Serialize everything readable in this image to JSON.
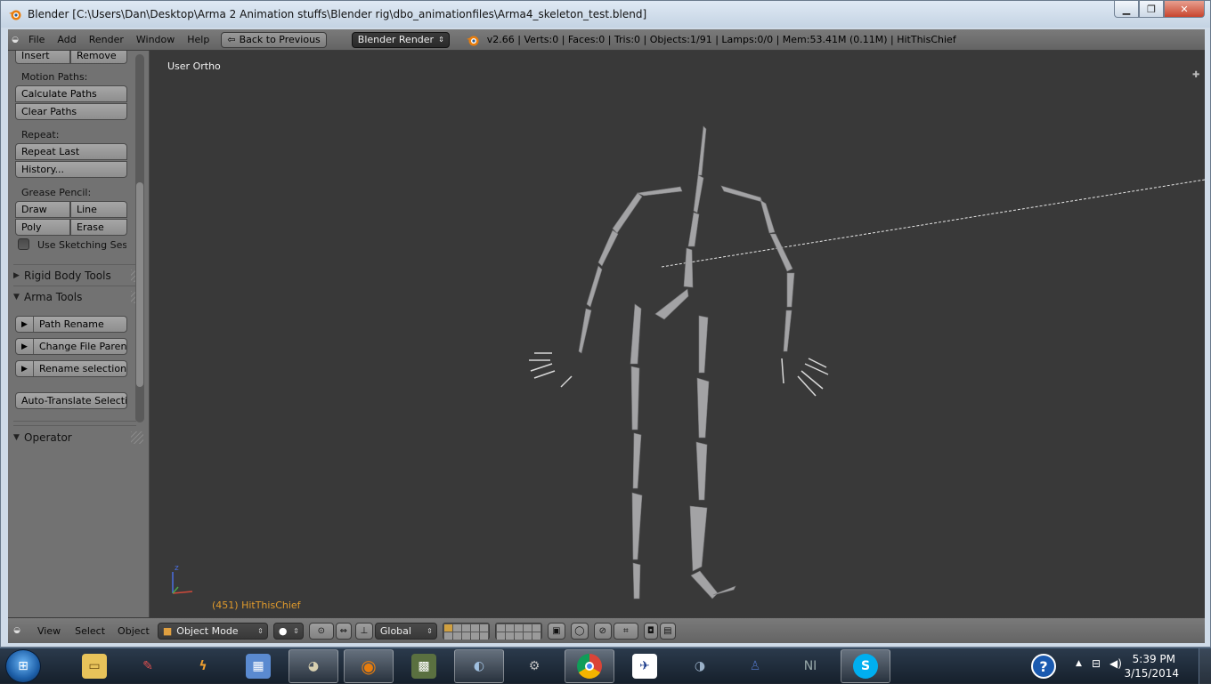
{
  "window": {
    "title": "Blender [C:\\Users\\Dan\\Desktop\\Arma 2 Animation stuffs\\Blender rig\\dbo_animationfiles\\Arma4_skeleton_test.blend]",
    "min_icon": "minimize-icon",
    "max_icon": "maximize-icon",
    "close_icon": "close-icon"
  },
  "info_header": {
    "menus": [
      "File",
      "Add",
      "Render",
      "Window",
      "Help"
    ],
    "back_button": "Back to Previous",
    "render_engine": "Blender Render",
    "stats": "v2.66 | Verts:0 | Faces:0 | Tris:0 | Objects:1/91 | Lamps:0/0 | Mem:53.41M (0.11M) | HitThisChief"
  },
  "toolshelf": {
    "insert": "Insert",
    "remove": "Remove",
    "motion_paths_label": "Motion Paths:",
    "calculate_paths": "Calculate Paths",
    "clear_paths": "Clear Paths",
    "repeat_label": "Repeat:",
    "repeat_last": "Repeat Last",
    "history": "History...",
    "grease_pencil_label": "Grease Pencil:",
    "draw": "Draw",
    "line": "Line",
    "poly": "Poly",
    "erase": "Erase",
    "use_sketching": "Use Sketching Sessi",
    "rigid_body_tools": "Rigid Body Tools",
    "arma_tools": "Arma Tools",
    "path_rename": "Path Rename",
    "change_file_parent": "Change File Parent",
    "rename_selections": "Rename selections",
    "auto_translate": "Auto-Translate Selectio",
    "operator": "Operator"
  },
  "viewport": {
    "view_name": "User Ortho",
    "object_label": "(451) HitThisChief",
    "axis_z": "z"
  },
  "view_header": {
    "menus": [
      "View",
      "Select",
      "Object"
    ],
    "mode": "Object Mode",
    "orientation": "Global"
  },
  "taskbar": {
    "time": "5:39 PM",
    "date": "3/15/2014",
    "apps": [
      "windows-explorer",
      "pencil-app",
      "winamp-app",
      "mspaint-app",
      "gimp-app",
      "blender-app",
      "game-app",
      "3d-app",
      "utility-app",
      "chrome-app",
      "dark-app",
      "bird-app",
      "person-app",
      "ni-mate-app",
      "skype-app"
    ],
    "ni_mate_text": "NI",
    "skype_text": "S",
    "help_text": "?"
  },
  "colors": {
    "viewport_bg": "#393939",
    "panel_bg": "#727272",
    "object_label": "#e09a2c"
  }
}
